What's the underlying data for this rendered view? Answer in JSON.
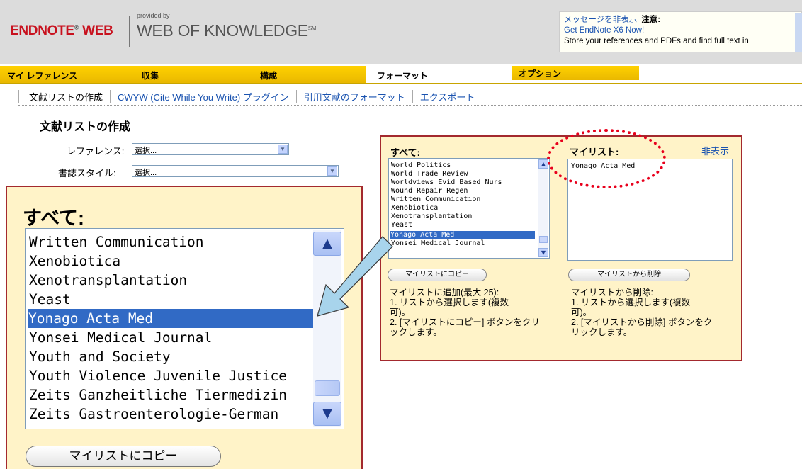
{
  "header": {
    "logo_endnote": "ENDNOTE",
    "logo_endnote_reg": "®",
    "logo_endnote_web": " WEB",
    "logo_provided": "provided by",
    "logo_wok": "WEB OF KNOWLEDGE",
    "logo_wok_sm": "SM",
    "message": {
      "hide_link": "メッセージを非表示",
      "title": "注意:",
      "line1": "Get EndNote X6 Now!",
      "line2": "Store your references and PDFs and find full text in"
    }
  },
  "tabs": [
    "マイ レファレンス",
    "収集",
    "構成",
    "フォーマット",
    "オプション"
  ],
  "subnav": [
    "文献リストの作成",
    "CWYW (Cite While You Write) プラグイン",
    "引用文献のフォーマット",
    "エクスポート"
  ],
  "page": {
    "title": "文献リストの作成",
    "reference_label": "レファレンス:",
    "reference_value": "選択...",
    "style_label": "書誌スタイル:",
    "style_value": "選択..."
  },
  "zoom": {
    "heading": "すべて:",
    "items": [
      "Written Communication",
      "Xenobiotica",
      "Xenotransplantation",
      "Yeast",
      "Yonago Acta Med",
      "Yonsei Medical Journal",
      "Youth and Society",
      "Youth Violence Juvenile Justice",
      "Zeits Ganzheitliche Tiermedizin",
      "Zeits Gastroenterologie-German"
    ],
    "selected": "Yonago Acta Med",
    "copy_button": "マイリストにコピー"
  },
  "small": {
    "all_heading": "すべて:",
    "my_heading": "マイリスト:",
    "hide_link": "非表示",
    "items": [
      "World Politics",
      "World Trade Review",
      "Worldviews Evid Based Nurs",
      "Wound Repair Regen",
      "Written Communication",
      "Xenobiotica",
      "Xenotransplantation",
      "Yeast",
      "Yonago Acta Med",
      "Yonsei Medical Journal"
    ],
    "my_items": [
      "Yonago Acta Med"
    ],
    "copy_button": "マイリストにコピー",
    "remove_button": "マイリストから削除",
    "add_instr": [
      "マイリストに追加(最大 25):",
      "1. リストから選択します(複数",
      "可)。",
      "2. [マイリストにコピー] ボタンをクリ",
      "ックします。"
    ],
    "remove_instr": [
      "マイリストから削除:",
      "1. リストから選択します(複数",
      "可)。",
      "2. [マイリストから削除] ボタンをク",
      "リックします。"
    ]
  },
  "colors": {
    "tab_gold": "#ffd100",
    "panel_bg": "#fff3c8",
    "panel_border": "#a3292e",
    "selection": "#316ac5",
    "link": "#1a53b0",
    "highlight_oval": "#e8001c",
    "arrow_fill": "#a8d4ec"
  },
  "icons": {
    "scroll_up": "chevron-up-icon",
    "scroll_down": "chevron-down-icon",
    "dropdown": "chevron-down-icon",
    "callout_arrow": "arrow-icon"
  }
}
